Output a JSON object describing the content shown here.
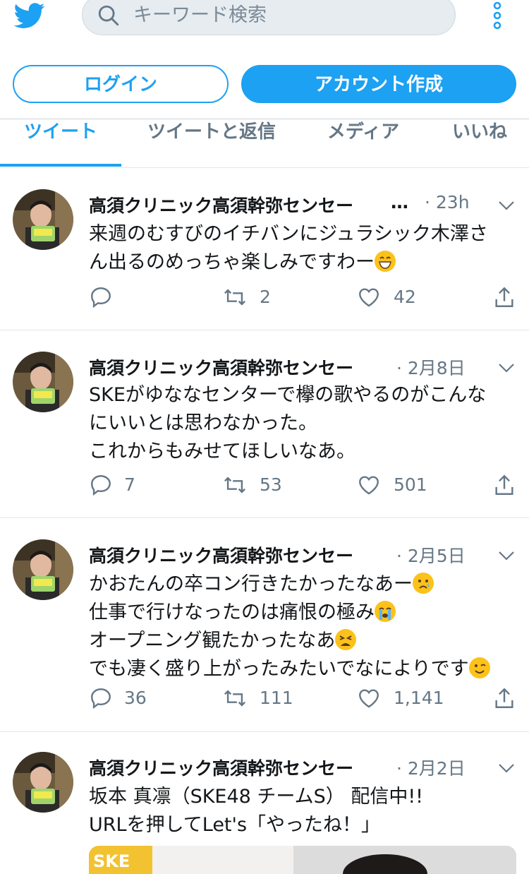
{
  "search": {
    "placeholder": "キーワード検索"
  },
  "auth": {
    "login_label": "ログイン",
    "signup_label": "アカウント作成"
  },
  "tabs": [
    {
      "label": "ツイート"
    },
    {
      "label": "ツイートと返信"
    },
    {
      "label": "メディア"
    },
    {
      "label": "いいね"
    }
  ],
  "colors": {
    "accent": "#1da1f2",
    "secondary_text": "#657786",
    "divider": "#e1e8ed"
  },
  "tweets": [
    {
      "name": "高須クリニック高須幹弥センセー",
      "truncated": "…",
      "time": "· 23h",
      "text": "来週のむすびのイチバンにジュラシック木澤さ\nん出るのめっちゃ楽しみですわー",
      "replies": "",
      "retweets": "2",
      "likes": "42"
    },
    {
      "name": "高須クリニック高須幹弥センセー",
      "time": "· 2月8日",
      "text": "SKEがゆななセンターで欅の歌やるのがこんな\nにいいとは思わなかった。\nこれからもみせてほしいなあ。",
      "replies": "7",
      "retweets": "53",
      "likes": "501"
    },
    {
      "name": "高須クリニック高須幹弥センセー",
      "time": "· 2月5日",
      "line1": "かおたんの卒コン行きたかったなあー",
      "line2": "仕事で行けなったのは痛恨の極み",
      "line3": "オープニング観たかったなあ",
      "line4": "でも凄く盛り上がったみたいでなによりです",
      "replies": "36",
      "retweets": "111",
      "likes": "1,141"
    },
    {
      "name": "高須クリニック高須幹弥センセー",
      "time": "· 2月2日",
      "text": "坂本 真凛（SKE48 チームS） 配信中!!\nURLを押してLet's「やったね！」"
    }
  ],
  "icons": [
    "twitter-bird-icon",
    "search-icon",
    "more-vertical-icon",
    "chevron-down-icon",
    "reply-icon",
    "retweet-icon",
    "like-icon",
    "share-icon",
    "emoji-grin-icon",
    "emoji-sad-icon",
    "emoji-cry-icon",
    "emoji-weary-icon",
    "emoji-wink-icon"
  ]
}
